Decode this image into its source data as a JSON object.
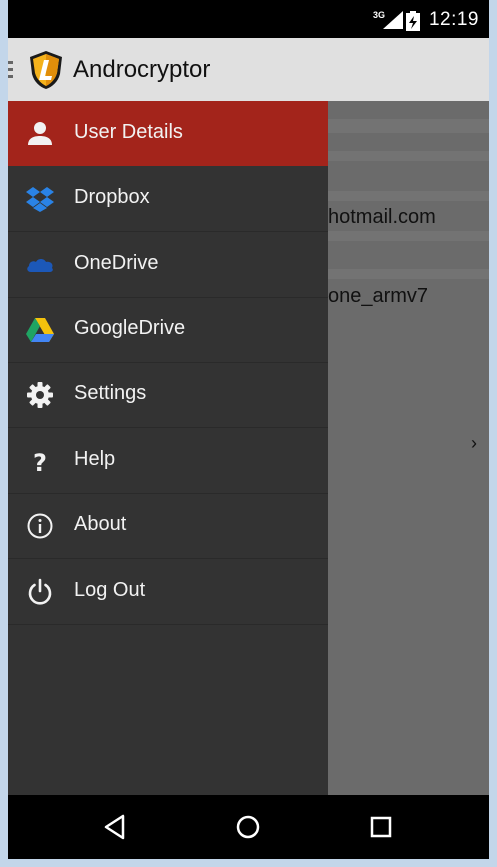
{
  "status_bar": {
    "network": "3G",
    "time": "12:19"
  },
  "app_bar": {
    "title": "Androcryptor"
  },
  "background": {
    "email_fragment": "hotmail.com",
    "device_fragment": "one_armv7",
    "chevron": "›"
  },
  "drawer": {
    "items": [
      {
        "label": "User Details",
        "icon": "person-icon",
        "active": true
      },
      {
        "label": "Dropbox",
        "icon": "dropbox-icon"
      },
      {
        "label": "OneDrive",
        "icon": "onedrive-icon"
      },
      {
        "label": "GoogleDrive",
        "icon": "googledrive-icon"
      },
      {
        "label": "Settings",
        "icon": "gear-icon"
      },
      {
        "label": "Help",
        "icon": "help-icon"
      },
      {
        "label": "About",
        "icon": "info-icon"
      },
      {
        "label": "Log Out",
        "icon": "power-icon"
      }
    ]
  },
  "colors": {
    "accent": "#a3241b",
    "drawer_bg": "#333333",
    "app_bar_bg": "#e0e0e0"
  }
}
